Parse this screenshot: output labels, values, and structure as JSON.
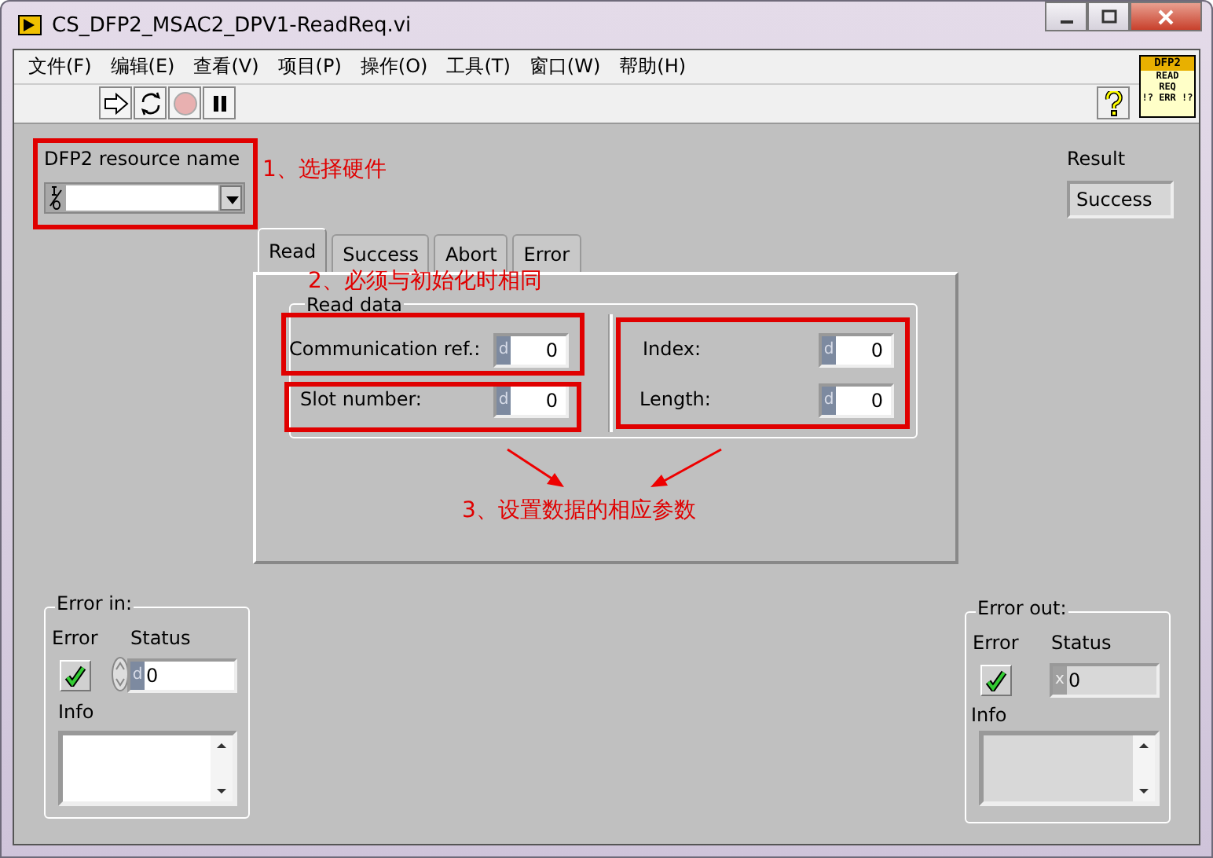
{
  "window": {
    "title": "CS_DFP2_MSAC2_DPV1-ReadReq.vi"
  },
  "menu": [
    "文件(F)",
    "编辑(E)",
    "查看(V)",
    "项目(P)",
    "操作(O)",
    "工具(T)",
    "窗口(W)",
    "帮助(H)"
  ],
  "vi_icon": {
    "lines": [
      "DFP2",
      "READ",
      "REQ",
      "!? ERR !?"
    ]
  },
  "resource": {
    "label": "DFP2 resource name"
  },
  "result": {
    "label": "Result",
    "value": "Success"
  },
  "tabs": [
    {
      "label": "Read",
      "selected": true
    },
    {
      "label": "Success",
      "selected": false
    },
    {
      "label": "Abort",
      "selected": false
    },
    {
      "label": "Error",
      "selected": false
    }
  ],
  "read_data": {
    "label": "Read data",
    "fields": [
      {
        "label": "Communication ref.:",
        "radix": "d",
        "value": "0"
      },
      {
        "label": "Slot number:",
        "radix": "d",
        "value": "0"
      },
      {
        "label": "Index:",
        "radix": "d",
        "value": "0"
      },
      {
        "label": "Length:",
        "radix": "d",
        "value": "0"
      }
    ]
  },
  "error_in": {
    "label": "Error in:",
    "error_label": "Error",
    "ok": true,
    "status_label": "Status",
    "status_radix": "d",
    "status": "0",
    "info_label": "Info"
  },
  "error_out": {
    "label": "Error out:",
    "error_label": "Error",
    "ok": true,
    "status_label": "Status",
    "status_radix": "x",
    "status": "0",
    "info_label": "Info"
  },
  "annotations": [
    "1、选择硬件",
    "2、必须与初始化时相同",
    "3、设置数据的相应参数"
  ]
}
